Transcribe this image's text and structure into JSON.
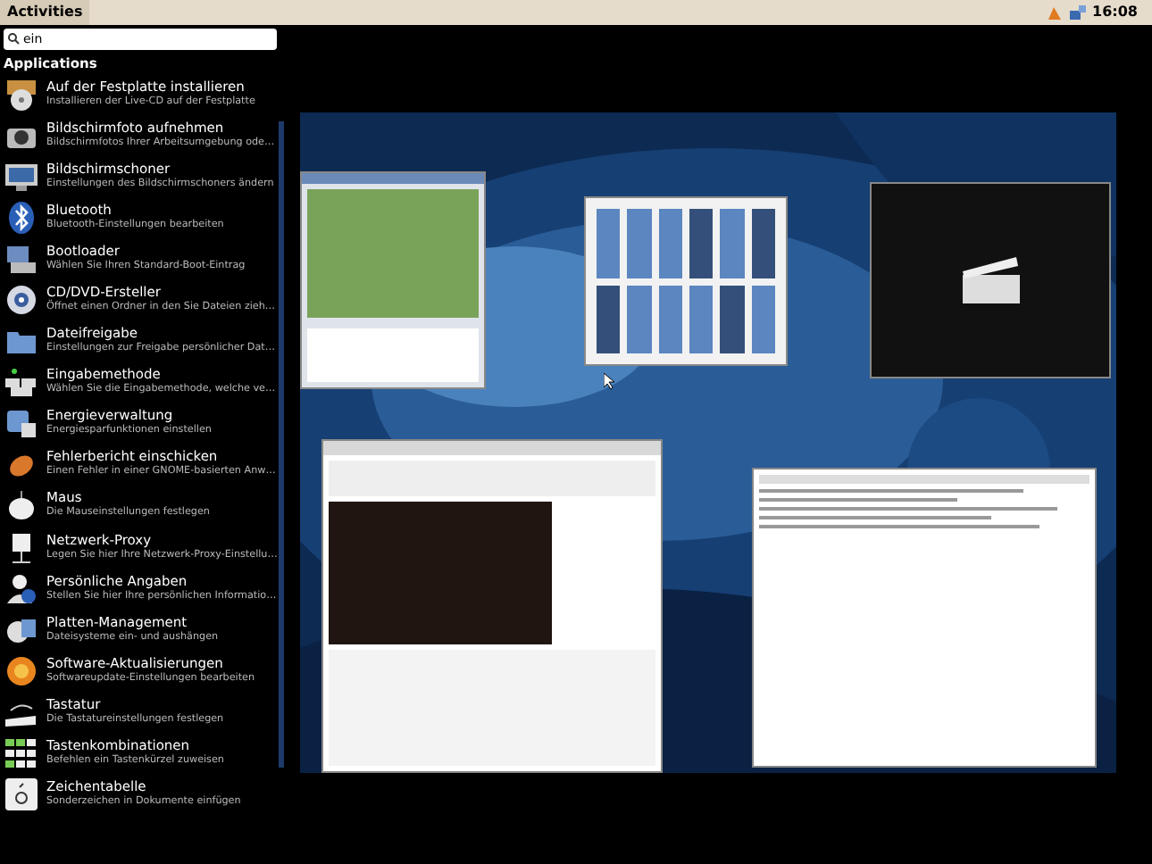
{
  "top_bar": {
    "activities": "Activities",
    "clock": "16:08"
  },
  "search": {
    "value": "ein"
  },
  "section_title": "Applications",
  "applications": [
    {
      "name": "Auf der Festplatte installieren",
      "description": "Installieren der Live-CD auf der Festplatte"
    },
    {
      "name": "Bildschirmfoto aufnehmen",
      "description": "Bildschirmfotos Ihrer Arbeitsumgebung ode…"
    },
    {
      "name": "Bildschirmschoner",
      "description": "Einstellungen des Bildschirmschoners ändern"
    },
    {
      "name": "Bluetooth",
      "description": "Bluetooth-Einstellungen bearbeiten"
    },
    {
      "name": "Bootloader",
      "description": "Wählen Sie Ihren Standard-Boot-Eintrag"
    },
    {
      "name": "CD/DVD-Ersteller",
      "description": "Öffnet einen Ordner in den Sie Dateien zieh…"
    },
    {
      "name": "Dateifreigabe",
      "description": "Einstellungen zur Freigabe persönlicher Dat…"
    },
    {
      "name": "Eingabemethode",
      "description": "Wählen Sie die Eingabemethode, welche ve…"
    },
    {
      "name": "Energieverwaltung",
      "description": "Energiesparfunktionen einstellen"
    },
    {
      "name": "Fehlerbericht einschicken",
      "description": "Einen Fehler in einer GNOME-basierten Anw…"
    },
    {
      "name": "Maus",
      "description": "Die Mauseinstellungen festlegen"
    },
    {
      "name": "Netzwerk-Proxy",
      "description": "Legen Sie hier Ihre Netzwerk-Proxy-Einstellu…"
    },
    {
      "name": "Persönliche Angaben",
      "description": "Stellen Sie hier Ihre persönlichen Informatio…"
    },
    {
      "name": "Platten-Management",
      "description": "Dateisysteme ein- und aushängen"
    },
    {
      "name": "Software-Aktualisierungen",
      "description": "Softwareupdate-Einstellungen bearbeiten"
    },
    {
      "name": "Tastatur",
      "description": "Die Tastatureinstellungen festlegen"
    },
    {
      "name": "Tastenkombinationen",
      "description": "Befehlen ein Tastenkürzel zuweisen"
    },
    {
      "name": "Zeichentabelle",
      "description": "Sonderzeichen in Dokumente einfügen"
    }
  ]
}
